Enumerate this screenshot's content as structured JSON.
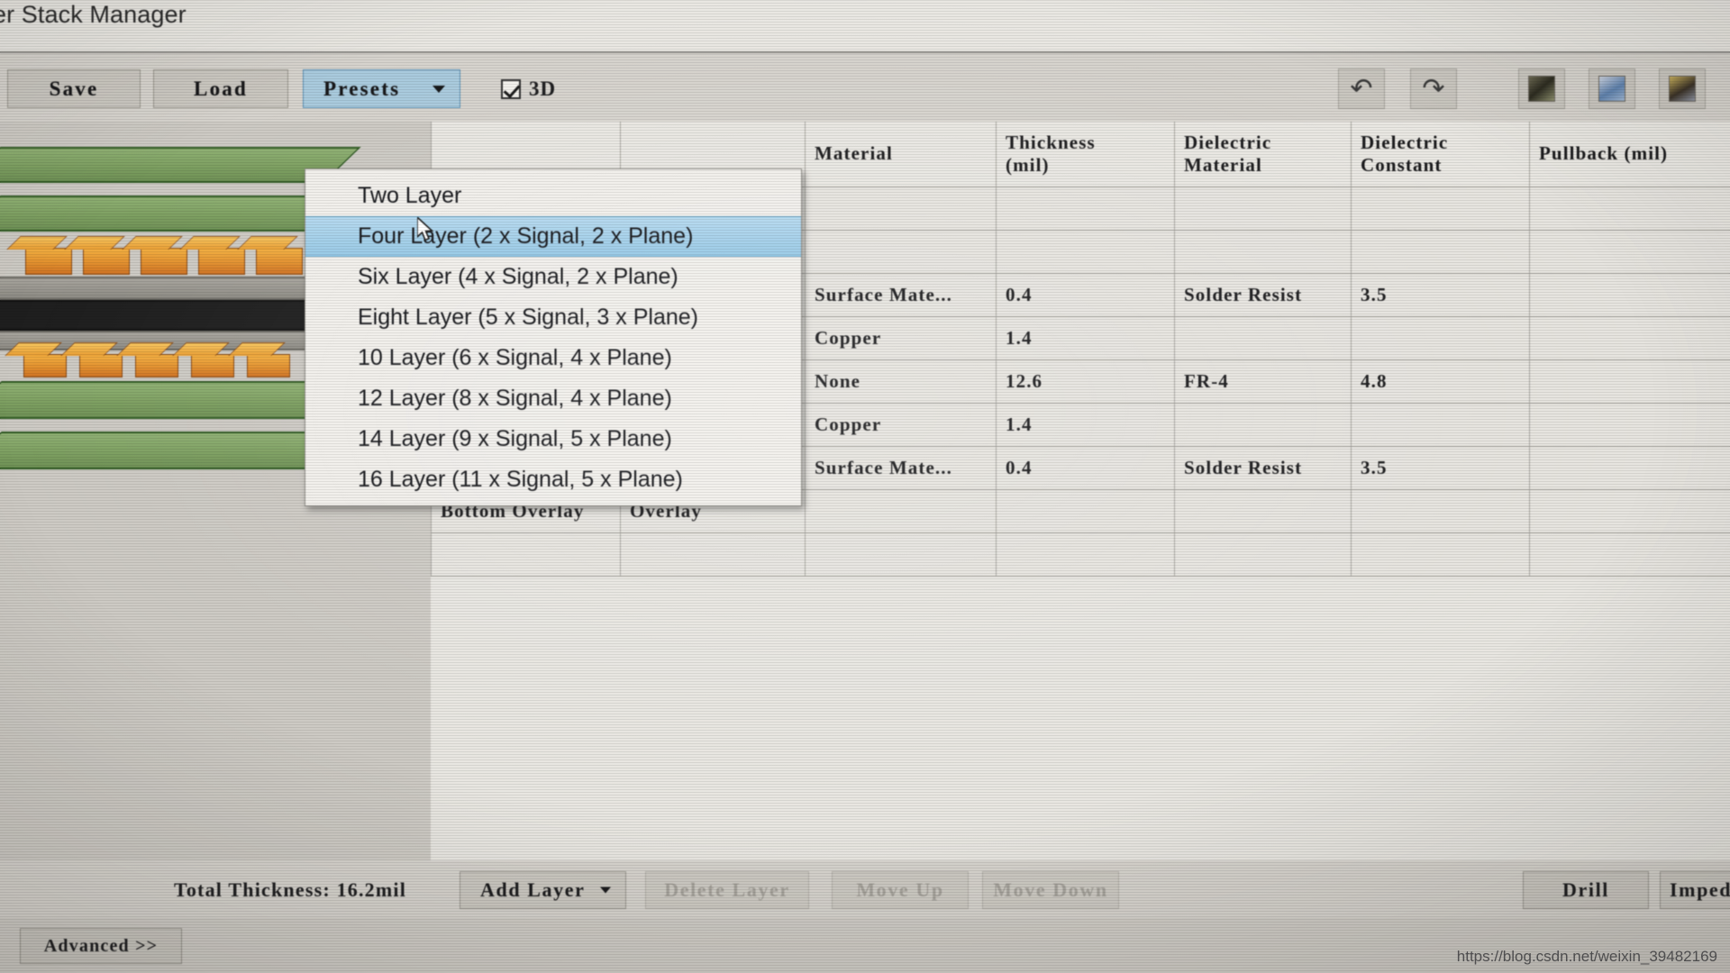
{
  "window": {
    "title": "er Stack Manager"
  },
  "toolbar": {
    "save_label": "Save",
    "load_label": "Load",
    "presets_label": "Presets",
    "threed_label": "3D",
    "threed_checked": true,
    "icons": {
      "undo": "undo-arrow-icon",
      "redo": "redo-arrow-icon",
      "tool1": "layer-stack-image-icon",
      "tool2": "copy-layers-icon",
      "tool3": "import-stack-icon"
    }
  },
  "presets_menu": {
    "selected_index": 1,
    "items": [
      "Two Layer",
      "Four Layer (2 x Signal, 2 x Plane)",
      "Six Layer (4 x Signal, 2 x Plane)",
      "Eight Layer (5 x Signal, 3 x Plane)",
      "10 Layer (6 x Signal, 4 x Plane)",
      "12 Layer (8 x Signal, 4 x Plane)",
      "14 Layer (9 x Signal, 5 x Plane)",
      "16 Layer (11 x Signal, 5 x Plane)"
    ]
  },
  "table": {
    "columns": [
      "",
      "",
      "Material",
      "Thickness\n(mil)",
      "Dielectric\nMaterial",
      "Dielectric\nConstant",
      "Pullback (mil)"
    ],
    "rows": [
      {
        "name": "",
        "type": "",
        "material": "",
        "thickness": "",
        "diel_material": "",
        "diel_constant": "",
        "pullback": ""
      },
      {
        "name": "",
        "type": "",
        "material": "",
        "thickness": "",
        "diel_material": "",
        "diel_constant": "",
        "pullback": ""
      },
      {
        "name": "",
        "type": "",
        "material": "Surface Mate...",
        "thickness": "0.4",
        "diel_material": "Solder Resist",
        "diel_constant": "3.5",
        "pullback": ""
      },
      {
        "name": "",
        "type": "",
        "material": "Copper",
        "thickness": "1.4",
        "diel_material": "",
        "diel_constant": "",
        "pullback": ""
      },
      {
        "name": "",
        "type": "",
        "material": "None",
        "thickness": "12.6",
        "diel_material": "FR-4",
        "diel_constant": "4.8",
        "pullback": ""
      },
      {
        "name": "",
        "type": "",
        "material": "Copper",
        "thickness": "1.4",
        "diel_material": "",
        "diel_constant": "",
        "pullback": ""
      },
      {
        "name": "",
        "type": "",
        "material": "Surface Mate...",
        "thickness": "0.4",
        "diel_material": "Solder Resist",
        "diel_constant": "3.5",
        "pullback": ""
      },
      {
        "name": "Bottom Overlay",
        "type": "Overlay",
        "material": "",
        "thickness": "",
        "diel_material": "",
        "diel_constant": "",
        "pullback": ""
      },
      {
        "name": "",
        "type": "",
        "material": "",
        "thickness": "",
        "diel_material": "",
        "diel_constant": "",
        "pullback": ""
      }
    ]
  },
  "statusbar": {
    "total_thickness": "Total Thickness: 16.2mil",
    "add_layer": "Add Layer",
    "delete_layer": "Delete Layer",
    "move_up": "Move Up",
    "move_down": "Move Down",
    "drill": "Drill",
    "impedance": "Impeda"
  },
  "footer": {
    "advanced": "Advanced >>"
  },
  "watermark": "https://blog.csdn.net/weixin_39482169",
  "colors": {
    "accent": "#a9cadd",
    "menu_select": "#97c9e6",
    "pcb_green": "#7ea062",
    "copper": "#e2912f",
    "window_bg": "#d4d1cb"
  }
}
